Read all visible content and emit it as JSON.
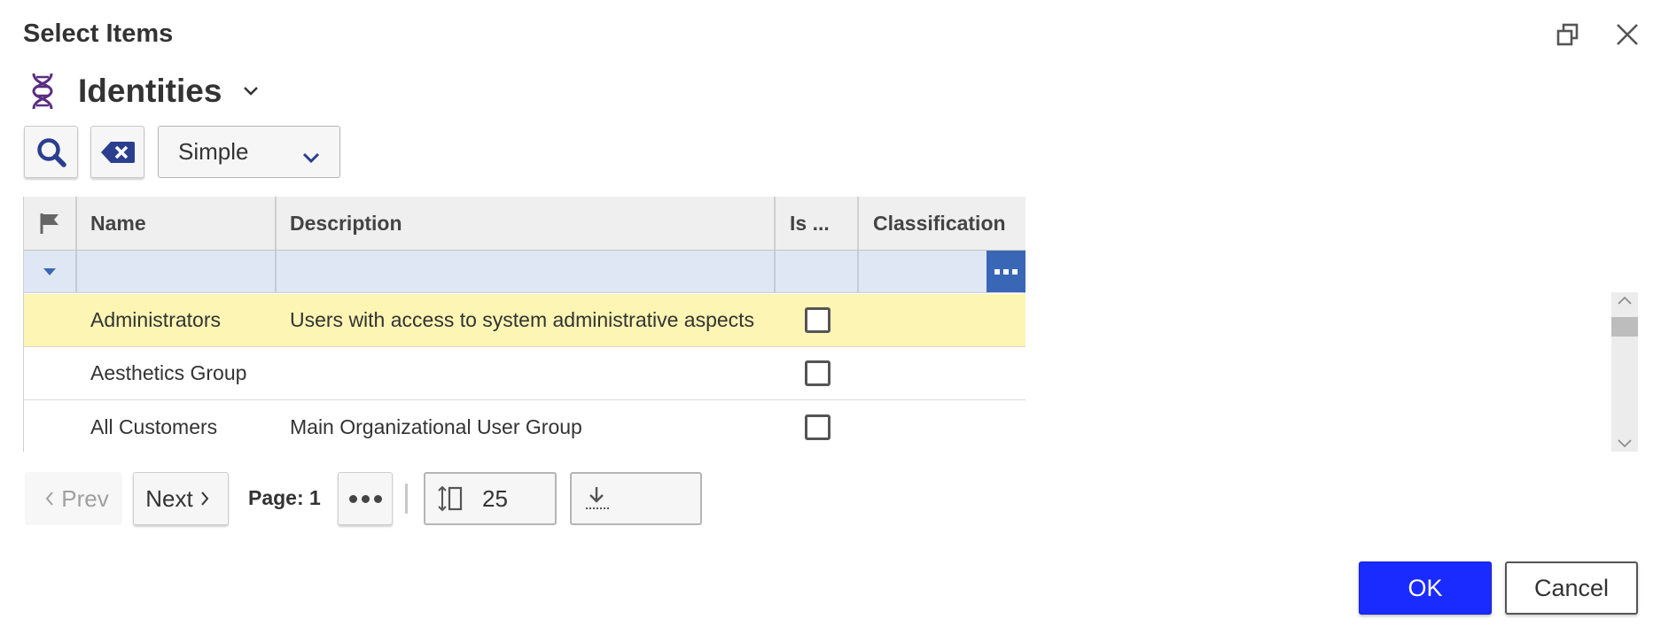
{
  "dialog": {
    "title": "Select Items",
    "icons": {
      "restore": "restore-window-icon",
      "close": "close-icon"
    }
  },
  "item_type": {
    "label": "Identities",
    "icon": "dna-icon",
    "accent_color": "#5b2d82"
  },
  "toolbar": {
    "search_icon": "search-icon",
    "clear_icon": "clear-backspace-icon",
    "search_mode": "Simple",
    "icon_color": "#2b3f8e"
  },
  "grid": {
    "columns": {
      "flag": "flag-icon",
      "name": "Name",
      "description": "Description",
      "is": "Is ...",
      "classification": "Classification"
    },
    "rows": [
      {
        "name": "Administrators",
        "description": "Users with access to system administrative aspects",
        "is_checked": false,
        "classification": "",
        "selected": true
      },
      {
        "name": "Aesthetics Group",
        "description": "",
        "is_checked": false,
        "classification": "",
        "selected": false
      },
      {
        "name": "All Customers",
        "description": "Main Organizational User Group",
        "is_checked": false,
        "classification": "",
        "selected": false
      }
    ],
    "colors": {
      "selected_row": "#fdf5b3",
      "filter_row": "#dfe7f5",
      "ellipsis_button": "#3a67b5"
    }
  },
  "pager": {
    "prev_label": "Prev",
    "next_label": "Next",
    "page_label": "Page: 1",
    "page_size": "25"
  },
  "footer": {
    "ok_label": "OK",
    "cancel_label": "Cancel",
    "ok_color": "#1a2bff"
  }
}
